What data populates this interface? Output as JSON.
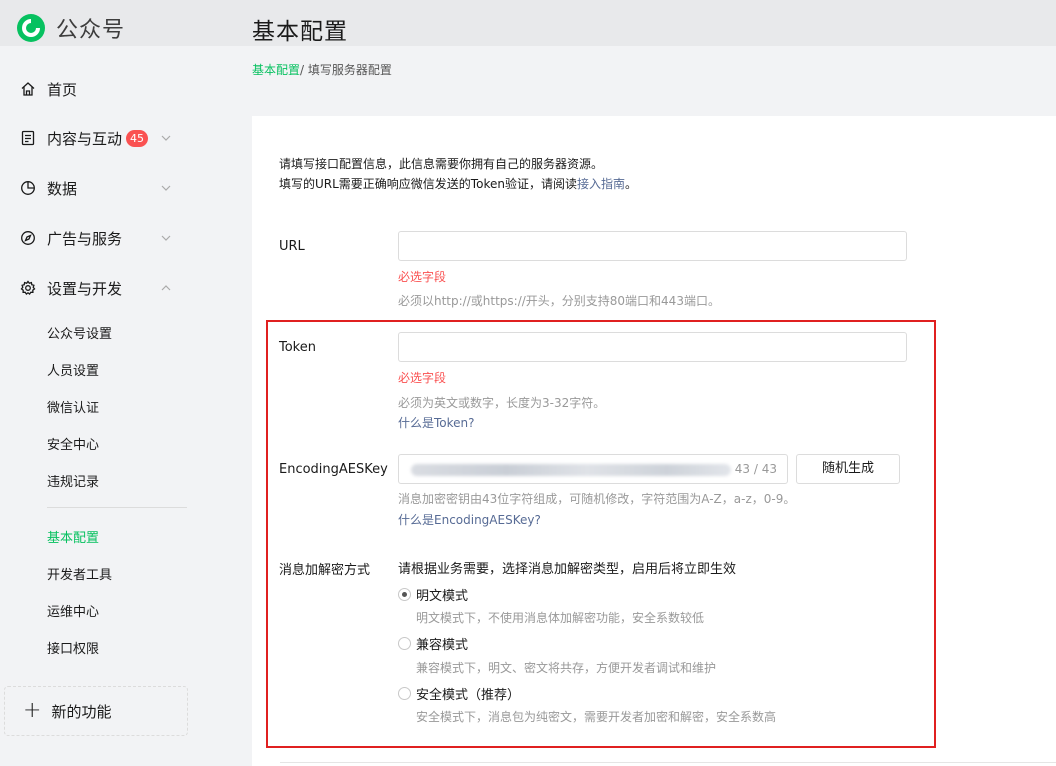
{
  "app": {
    "logo_text": "公众号",
    "page_title": "基本配置"
  },
  "sidebar": {
    "home": {
      "label": "首页",
      "icon": "home-icon"
    },
    "content": {
      "label": "内容与互动",
      "badge": "45",
      "icon": "document-icon"
    },
    "data": {
      "label": "数据",
      "icon": "pie-chart-icon"
    },
    "ads": {
      "label": "广告与服务",
      "icon": "compass-icon"
    },
    "settings": {
      "label": "设置与开发",
      "icon": "gear-icon"
    },
    "sub_items": [
      "公众号设置",
      "人员设置",
      "微信认证",
      "安全中心",
      "违规记录",
      "基本配置",
      "开发者工具",
      "运维中心",
      "接口权限"
    ],
    "active_sub": "基本配置",
    "new_feature": "新的功能"
  },
  "breadcrumb": {
    "parent": "基本配置",
    "current": "/ 填写服务器配置"
  },
  "form": {
    "intro_line1": "请填写接口配置信息，此信息需要你拥有自己的服务器资源。",
    "intro_line2_prefix": "填写的URL需要正确响应微信发送的Token验证，请阅读",
    "intro_link": "接入指南",
    "intro_line2_suffix": "。",
    "url": {
      "label": "URL",
      "value": "",
      "error": "必选字段",
      "hint": "必须以http://或https://开头，分别支持80端口和443端口。"
    },
    "token": {
      "label": "Token",
      "value": "",
      "error": "必选字段",
      "hint": "必须为英文或数字，长度为3-32字符。",
      "help": "什么是Token?"
    },
    "aes": {
      "label": "EncodingAESKey",
      "count": "43 / 43",
      "button": "随机生成",
      "hint": "消息加密密钥由43位字符组成，可随机修改，字符范围为A-Z，a-z，0-9。",
      "help": "什么是EncodingAESKey?"
    },
    "mode": {
      "label": "消息加解密方式",
      "desc": "请根据业务需要，选择消息加解密类型，启用后将立即生效",
      "selected": "明文模式",
      "options": [
        {
          "label": "明文模式",
          "desc": "明文模式下，不使用消息体加解密功能，安全系数较低"
        },
        {
          "label": "兼容模式",
          "desc": "兼容模式下，明文、密文将共存，方便开发者调试和维护"
        },
        {
          "label": "安全模式（推荐）",
          "desc": "安全模式下，消息包为纯密文，需要开发者加密和解密，安全系数高"
        }
      ]
    }
  },
  "colors": {
    "accent": "#07c160",
    "error": "#fa5151",
    "link": "#576b95",
    "highlight": "#e02020"
  }
}
